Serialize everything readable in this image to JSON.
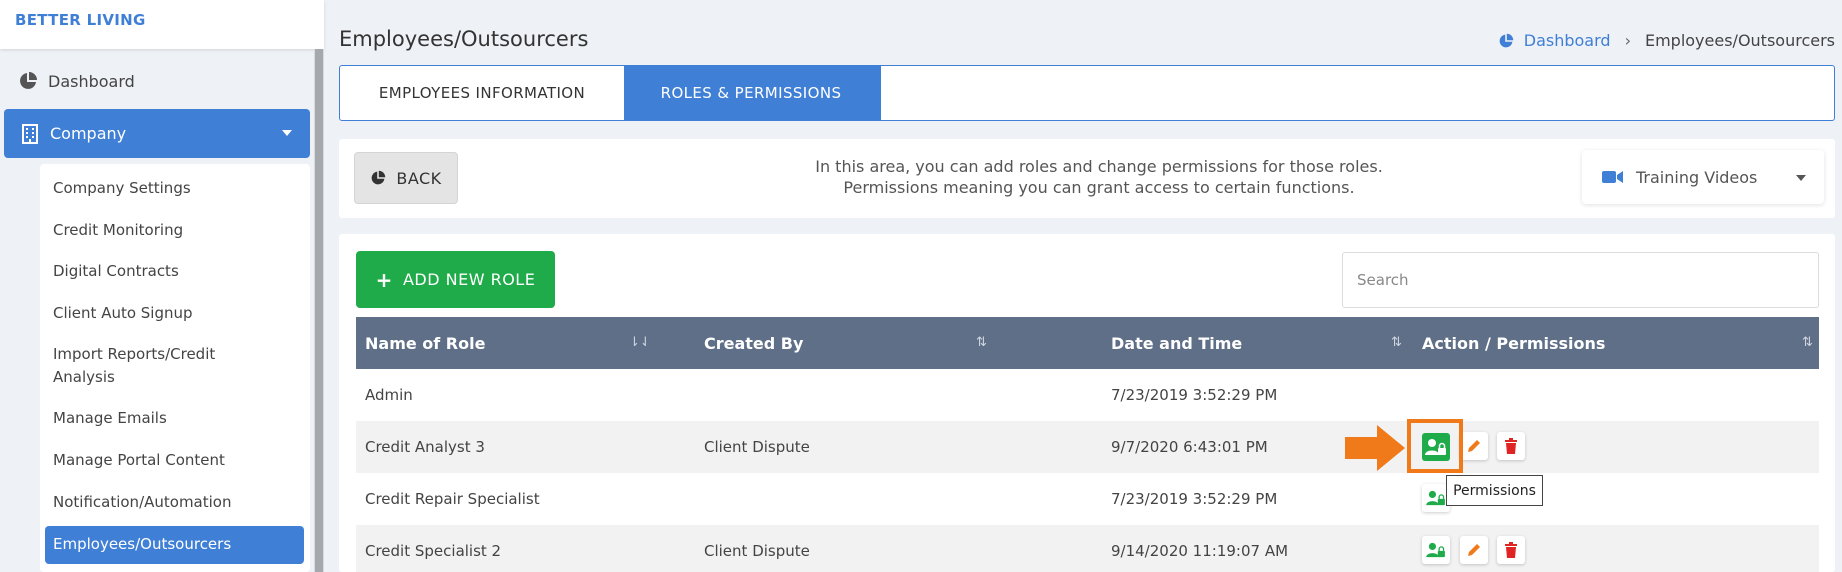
{
  "brand": "BETTER LIVING",
  "sidebar": {
    "dashboard_label": "Dashboard",
    "company_label": "Company",
    "submenu": [
      "Company Settings",
      "Credit Monitoring",
      "Digital Contracts",
      "Client Auto Signup",
      "Import Reports/Credit Analysis",
      "Manage Emails",
      "Manage Portal Content",
      "Notification/Automation",
      "Employees/Outsourcers"
    ]
  },
  "header": {
    "title": "Employees/Outsourcers",
    "breadcrumb": {
      "link": "Dashboard",
      "current": "Employees/Outsourcers"
    }
  },
  "tabs": [
    {
      "label": "EMPLOYEES INFORMATION",
      "active": false
    },
    {
      "label": "ROLES & PERMISSIONS",
      "active": true
    }
  ],
  "infobar": {
    "back_label": "BACK",
    "text_line1": "In this area, you can add roles and change permissions for those roles.",
    "text_line2": "Permissions meaning you can grant access to certain functions.",
    "training_label": "Training Videos"
  },
  "toolbar": {
    "add_role_label": "ADD NEW ROLE",
    "search_placeholder": "Search"
  },
  "table": {
    "columns": [
      "Name of Role",
      "Created By",
      "Date and Time",
      "Action / Permissions"
    ],
    "rows": [
      {
        "name": "Admin",
        "created_by": "",
        "datetime": "7/23/2019 3:52:29 PM"
      },
      {
        "name": "Credit Analyst 3",
        "created_by": "Client Dispute",
        "datetime": "9/7/2020 6:43:01 PM"
      },
      {
        "name": "Credit Repair Specialist",
        "created_by": "",
        "datetime": "7/23/2019 3:52:29 PM"
      },
      {
        "name": "Credit Specialist 2",
        "created_by": "Client Dispute",
        "datetime": "9/14/2020 11:19:07 AM"
      }
    ]
  },
  "tooltip": "Permissions",
  "colors": {
    "primary": "#3f7fd6",
    "success": "#1fab4a",
    "danger": "#e02424",
    "edit": "#f07a1a",
    "table_header": "#5f6f87",
    "annotation": "#f07a1a"
  },
  "icons": {
    "dashboard": "pie-chart-icon",
    "company": "building-icon",
    "training": "video-camera-icon",
    "permissions": "user-lock-icon",
    "edit": "pencil-icon",
    "delete": "trash-icon"
  }
}
